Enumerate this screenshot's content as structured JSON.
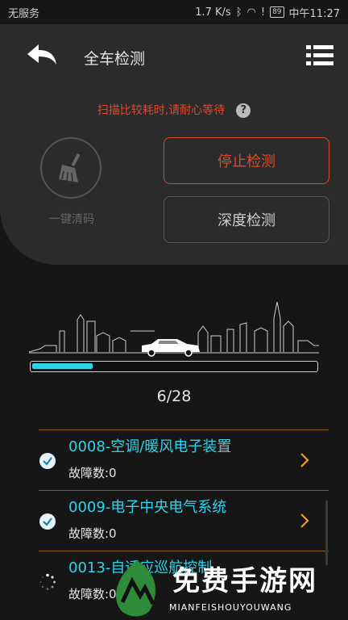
{
  "status_bar": {
    "carrier": "无服务",
    "speed": "1.7 K/s",
    "battery": "89",
    "time": "中午11:27"
  },
  "header": {
    "title": "全车检测",
    "hint": "扫描比较耗时,请耐心等待"
  },
  "actions": {
    "clean_label": "一键清码",
    "stop_label": "停止检测",
    "deep_label": "深度检测"
  },
  "progress": {
    "current": 6,
    "total": 28,
    "text": "6/28",
    "fraction": 0.214
  },
  "colors": {
    "accent": "#2fd3ea",
    "warning": "#e0492c",
    "chevron": "#f0a020"
  },
  "items": [
    {
      "name": "0008-空调/暖风电子装置",
      "faults": "故障数:0",
      "status": "done"
    },
    {
      "name": "0009-电子中央电气系统",
      "faults": "故障数:0",
      "status": "done"
    },
    {
      "name": "0013-自适应巡航控制",
      "faults": "故障数:0",
      "status": "loading"
    }
  ],
  "watermark": {
    "title": "免费手游网",
    "subtitle": "MIANFEISHOUYOUWANG"
  }
}
